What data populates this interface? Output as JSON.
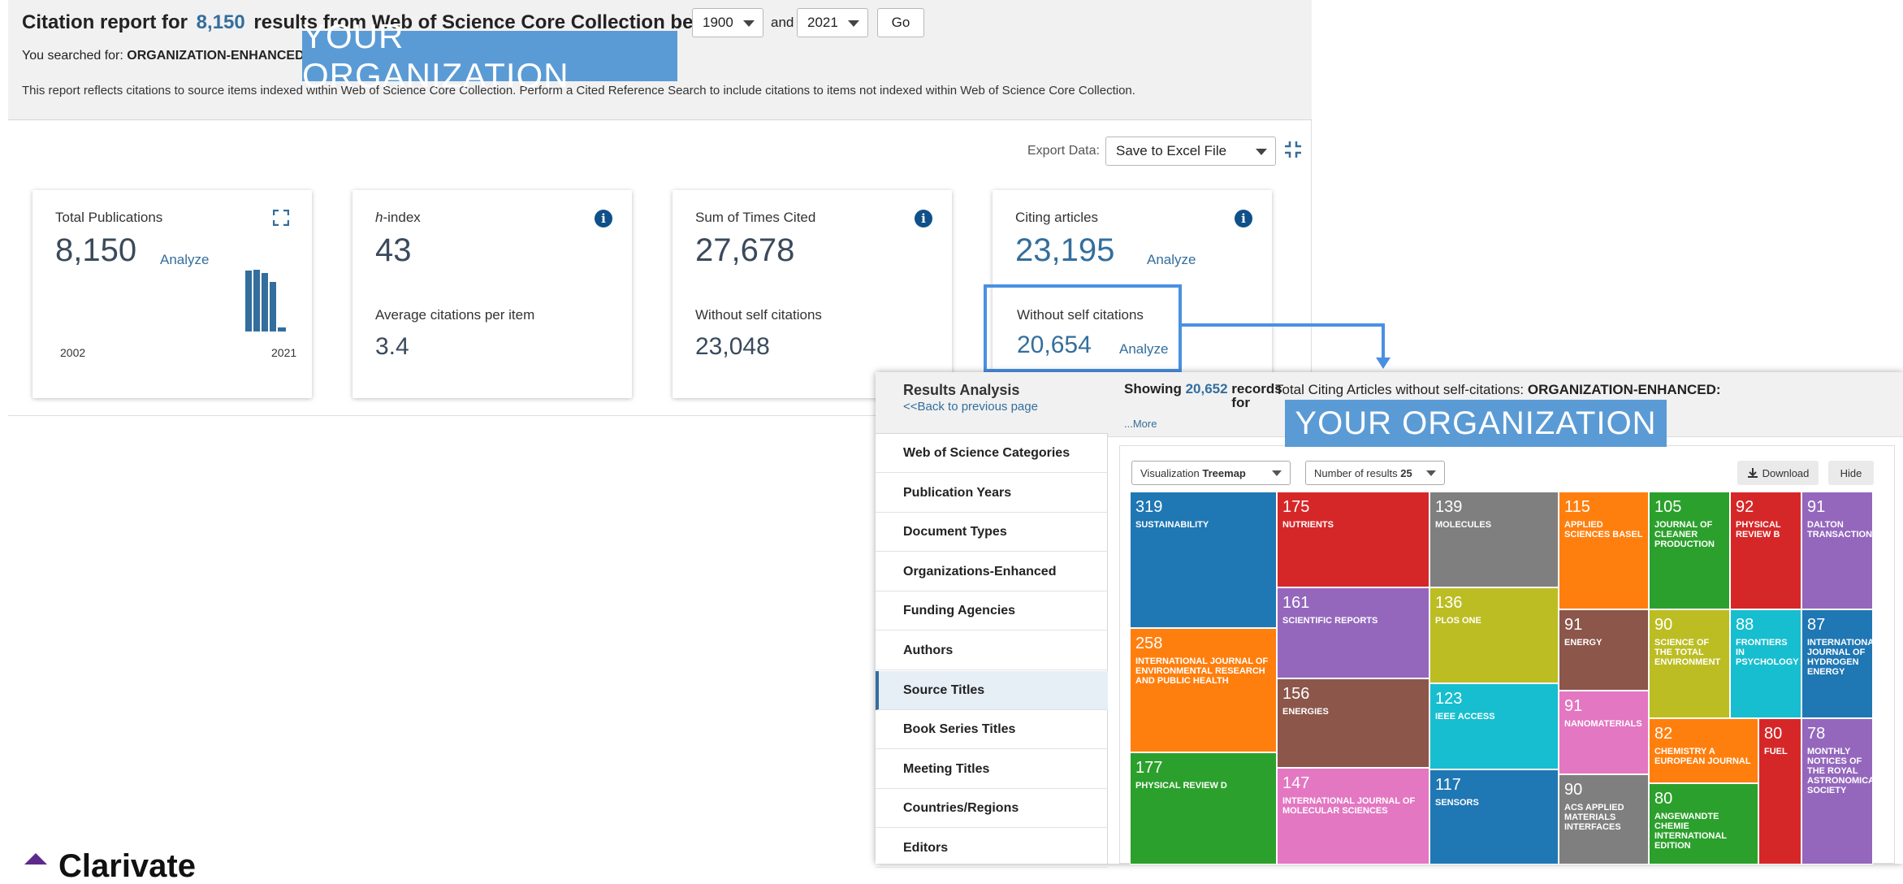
{
  "report": {
    "title_prefix": "Citation report for",
    "total_results": "8,150",
    "title_mid": "results from Web of Science Core Collection between",
    "year_from": "1900",
    "year_and": "and",
    "year_to": "2021",
    "go_label": "Go",
    "searched_prefix": "You searched for:",
    "searched_field": "ORGANIZATION-ENHANCED:",
    "searched_tail": "(",
    "org_overlay": "YOUR ORGANIZATION",
    "note": "This report reflects citations to source items indexed within Web of Science Core Collection. Perform a Cited Reference Search to include citations to items not indexed within Web of Science Core Collection.",
    "export_label": "Export Data:",
    "export_value": "Save to Excel File"
  },
  "cards": {
    "total_publications": {
      "label": "Total Publications",
      "value": "8,150",
      "analyze": "Analyze",
      "year_start": "2002",
      "year_end": "2021",
      "spark": [
        0.96,
        0.98,
        0.92,
        0.78,
        0.06
      ]
    },
    "h_index": {
      "label_h": "h",
      "label_rest": "-index",
      "value": "43",
      "sub_label": "Average citations per item",
      "sub_value": "3.4"
    },
    "times_cited": {
      "label": "Sum of Times Cited",
      "value": "27,678",
      "sub_label": "Without self citations",
      "sub_value": "23,048"
    },
    "citing": {
      "label": "Citing articles",
      "value": "23,195",
      "analyze": "Analyze",
      "sub_label": "Without self citations",
      "sub_value": "20,654",
      "sub_analyze": "Analyze"
    }
  },
  "analysis": {
    "title": "Results Analysis",
    "back": "<<Back to previous page",
    "showing": "Showing",
    "count": "20,652",
    "records_for": "records for",
    "total_label": "Total Citing Articles without self-citations:",
    "total_field": "ORGANIZATION-ENHANCED:",
    "more": "...More",
    "org_overlay": "YOUR ORGANIZATION",
    "viz_label": "Visualization",
    "viz_value": "Treemap",
    "num_label": "Number of results",
    "num_value": "25",
    "download": "Download",
    "hide": "Hide",
    "side_items": [
      "Web of Science Categories",
      "Publication Years",
      "Document Types",
      "Organizations-Enhanced",
      "Funding Agencies",
      "Authors",
      "Source Titles",
      "Book Series Titles",
      "Meeting Titles",
      "Countries/Regions",
      "Editors"
    ],
    "active_item": "Source Titles"
  },
  "treemap": [
    {
      "value": "319",
      "name": "Sustainability",
      "color": "#1f77b4"
    },
    {
      "value": "258",
      "name": "International Journal of Environmental Research and Public Health",
      "color": "#ff7f0e"
    },
    {
      "value": "177",
      "name": "Physical Review D",
      "color": "#2ca02c"
    },
    {
      "value": "175",
      "name": "Nutrients",
      "color": "#d62728"
    },
    {
      "value": "161",
      "name": "Scientific Reports",
      "color": "#9467bd"
    },
    {
      "value": "156",
      "name": "Energies",
      "color": "#8c564b"
    },
    {
      "value": "147",
      "name": "International Journal of Molecular Sciences",
      "color": "#e377c2"
    },
    {
      "value": "139",
      "name": "Molecules",
      "color": "#7f7f7f"
    },
    {
      "value": "136",
      "name": "PLOS ONE",
      "color": "#bcbd22"
    },
    {
      "value": "123",
      "name": "IEEE Access",
      "color": "#17becf"
    },
    {
      "value": "117",
      "name": "Sensors",
      "color": "#1f77b4"
    },
    {
      "value": "115",
      "name": "Applied Sciences Basel",
      "color": "#ff7f0e"
    },
    {
      "value": "91",
      "name": "Energy",
      "color": "#8c564b"
    },
    {
      "value": "91",
      "name": "Nanomaterials",
      "color": "#e377c2"
    },
    {
      "value": "90",
      "name": "ACS Applied Materials Interfaces",
      "color": "#7f7f7f"
    },
    {
      "value": "105",
      "name": "Journal of Cleaner Production",
      "color": "#2ca02c"
    },
    {
      "value": "90",
      "name": "Science of the Total Environment",
      "color": "#bcbd22"
    },
    {
      "value": "82",
      "name": "Chemistry A European Journal",
      "color": "#ff7f0e"
    },
    {
      "value": "80",
      "name": "Angewandte Chemie International Edition",
      "color": "#2ca02c"
    },
    {
      "value": "92",
      "name": "Physical Review B",
      "color": "#d62728"
    },
    {
      "value": "88",
      "name": "Frontiers in Psychology",
      "color": "#17becf"
    },
    {
      "value": "80",
      "name": "Fuel",
      "color": "#d62728"
    },
    {
      "value": "91",
      "name": "Dalton Transactions",
      "color": "#9467bd"
    },
    {
      "value": "87",
      "name": "International Journal of Hydrogen Energy",
      "color": "#1f77b4"
    },
    {
      "value": "78",
      "name": "Monthly Notices of the Royal Astronomical Society",
      "color": "#9467bd"
    }
  ],
  "footer": {
    "brand": "Clarivate"
  }
}
